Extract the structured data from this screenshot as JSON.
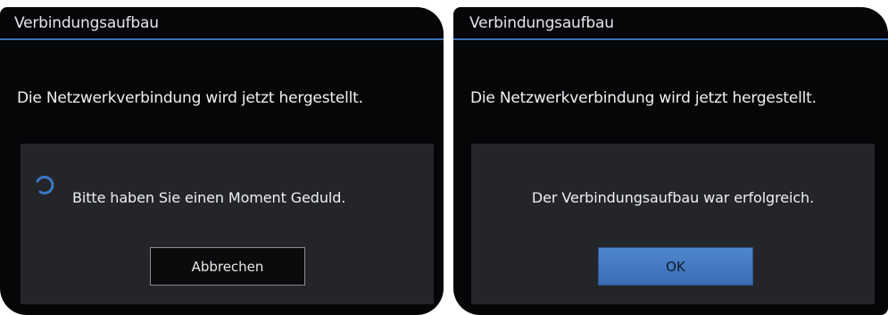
{
  "dialogs": [
    {
      "title": "Verbindungsaufbau",
      "message": "Die Netzwerkverbindung wird jetzt hergestellt.",
      "status_icon": "spinner-icon",
      "status_text": "Bitte haben Sie einen Moment Geduld.",
      "button_label": "Abbrechen"
    },
    {
      "title": "Verbindungsaufbau",
      "message": "Die Netzwerkverbindung wird jetzt hergestellt.",
      "status_text": "Der Verbindungsaufbau war erfolgreich.",
      "button_label": "OK"
    }
  ],
  "colors": {
    "accent": "#3f6fb4",
    "ok_button": "#4a7fc6",
    "panel_bg": "#050608",
    "inner_bg": "#232528"
  }
}
